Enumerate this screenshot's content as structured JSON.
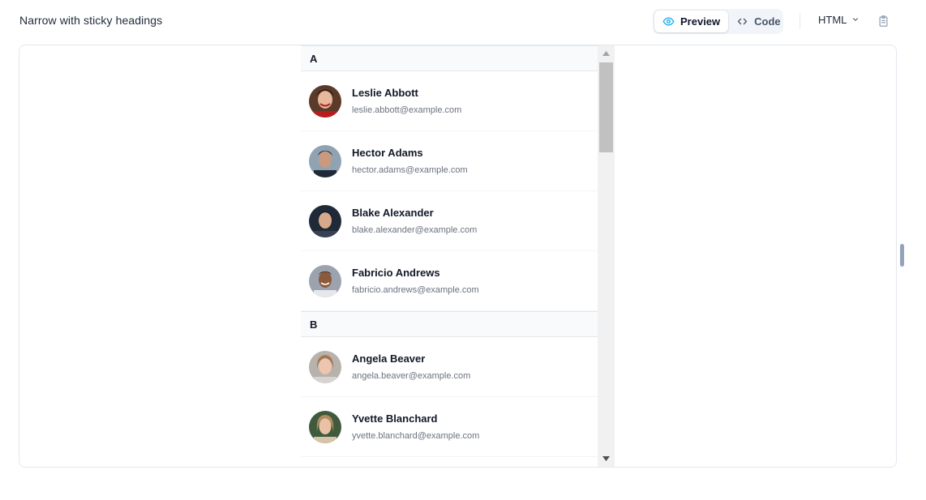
{
  "page": {
    "title": "Narrow with sticky headings"
  },
  "toolbar": {
    "tabs": [
      {
        "label": "Preview",
        "icon": "eye-icon",
        "active": true
      },
      {
        "label": "Code",
        "icon": "code-icon",
        "active": false
      }
    ],
    "language": "HTML",
    "copy_icon": "clipboard-icon"
  },
  "colors": {
    "accent": "#0ea5e9",
    "group_bg": "#f8fafc",
    "scrollbar_track": "#f1f1f1",
    "scrollbar_thumb": "#c1c1c1"
  },
  "directory": {
    "groups": [
      {
        "letter": "A",
        "people": [
          {
            "name": "Leslie Abbott",
            "email": "leslie.abbott@example.com",
            "avatar": "avatar-leslie"
          },
          {
            "name": "Hector Adams",
            "email": "hector.adams@example.com",
            "avatar": "avatar-hector"
          },
          {
            "name": "Blake Alexander",
            "email": "blake.alexander@example.com",
            "avatar": "avatar-blake"
          },
          {
            "name": "Fabricio Andrews",
            "email": "fabricio.andrews@example.com",
            "avatar": "avatar-fabricio"
          }
        ]
      },
      {
        "letter": "B",
        "people": [
          {
            "name": "Angela Beaver",
            "email": "angela.beaver@example.com",
            "avatar": "avatar-angela"
          },
          {
            "name": "Yvette Blanchard",
            "email": "yvette.blanchard@example.com",
            "avatar": "avatar-yvette"
          }
        ]
      }
    ]
  }
}
